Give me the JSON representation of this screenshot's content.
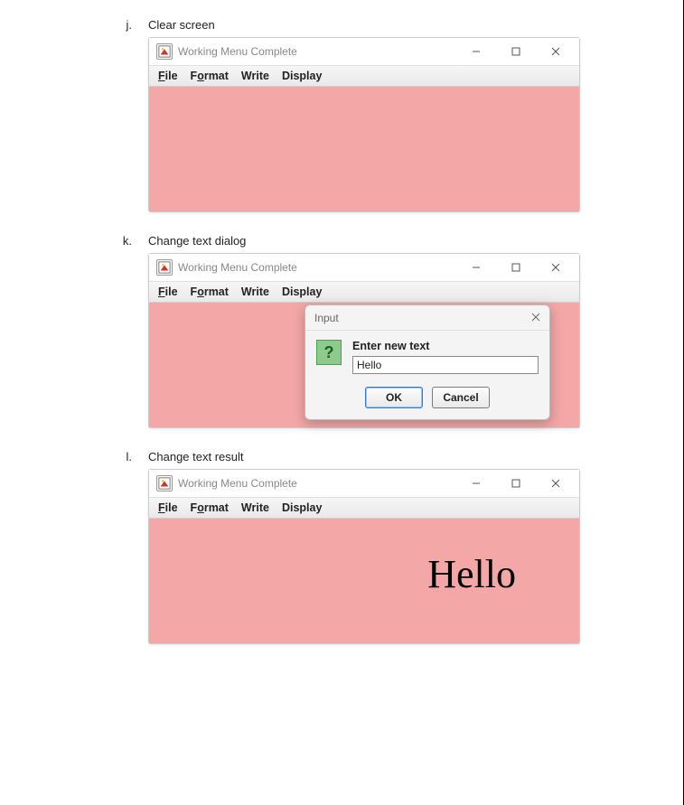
{
  "items": [
    {
      "letter": "j.",
      "caption": "Clear screen"
    },
    {
      "letter": "k.",
      "caption": "Change text dialog"
    },
    {
      "letter": "l.",
      "caption": "Change text result"
    }
  ],
  "window": {
    "title": "Working Menu Complete",
    "menus": {
      "file": {
        "label": "File",
        "underline": "F"
      },
      "format": {
        "label": "Format",
        "underline": "o"
      },
      "write": {
        "label": "Write"
      },
      "display": {
        "label": "Display"
      }
    }
  },
  "dialog": {
    "title": "Input",
    "prompt": "Enter new text",
    "value": "Hello",
    "ok": "OK",
    "cancel": "Cancel"
  },
  "result": {
    "text": "Hello"
  }
}
